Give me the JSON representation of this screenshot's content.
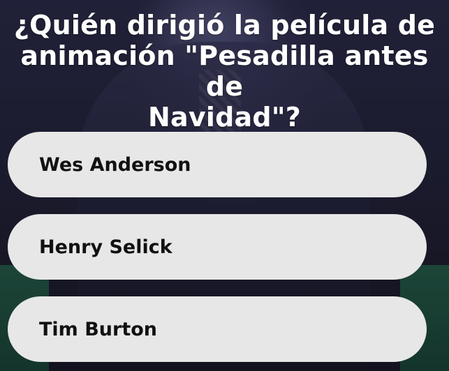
{
  "quiz": {
    "question_lines": [
      "¿Quién dirigió la película de",
      "animación \"Pesadilla antes de",
      "Navidad\"?"
    ],
    "answers": [
      {
        "label": "Wes Anderson"
      },
      {
        "label": "Henry Selick"
      },
      {
        "label": "Tim Burton"
      }
    ]
  },
  "colors": {
    "answer_background": "#e7e7e7",
    "answer_text": "#111111",
    "question_text": "#ffffff"
  }
}
